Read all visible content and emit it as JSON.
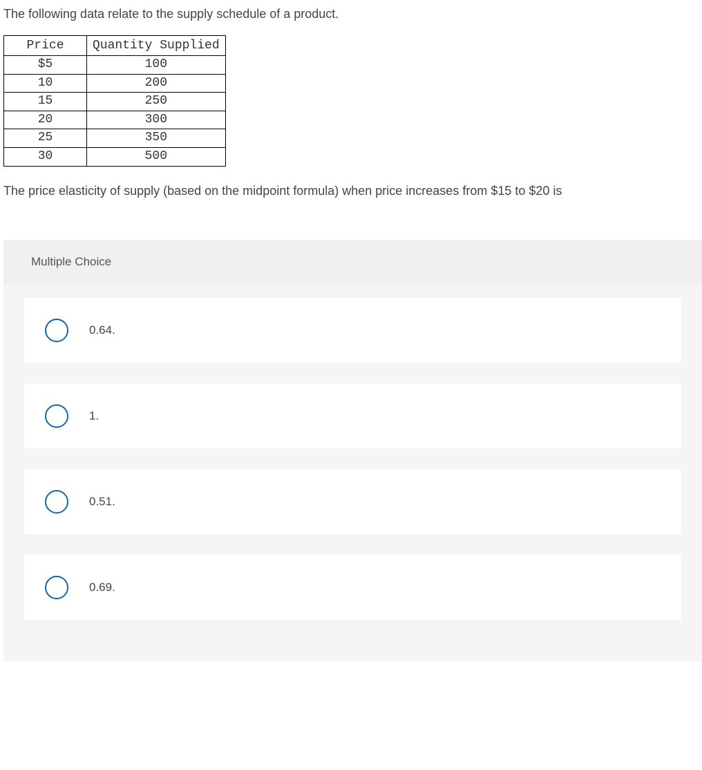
{
  "intro": "The following data relate to the supply schedule of a product.",
  "table": {
    "headers": [
      "Price",
      "Quantity Supplied"
    ],
    "rows": [
      [
        "$5",
        "100"
      ],
      [
        "10",
        "200"
      ],
      [
        "15",
        "250"
      ],
      [
        "20",
        "300"
      ],
      [
        "25",
        "350"
      ],
      [
        "30",
        "500"
      ]
    ]
  },
  "question": "The price elasticity of supply (based on the midpoint formula) when price increases from $15 to $20 is",
  "mc_header": "Multiple Choice",
  "options": [
    "0.64.",
    "1.",
    "0.51.",
    "0.69."
  ]
}
